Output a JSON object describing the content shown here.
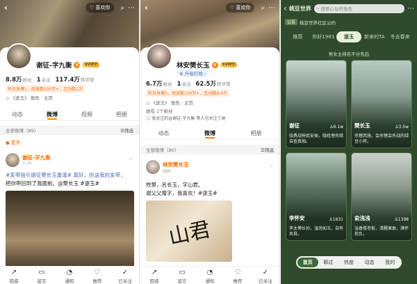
{
  "panel1": {
    "topbar": {
      "back": "‹",
      "pill": "喜欢你",
      "icons": [
        "search-icon",
        "more-icon"
      ]
    },
    "user": {
      "name": "谢征-字九衡",
      "svip": "SVIP7"
    },
    "stats": [
      {
        "num": "8.8万",
        "label": "粉丝"
      },
      {
        "num": "1",
        "label": "关注"
      },
      {
        "num": "117.4万",
        "label": "转评赞"
      }
    ],
    "tags": [
      "昨日发博1，阅读数100万+，互动数1万"
    ],
    "info": "《逐玉》 角色 · 主页",
    "info2": "谢征 角色微博",
    "tabs": [
      "动态",
      "微博",
      "视频",
      "相册"
    ],
    "active_tab": "微博",
    "feed_head": "全部微博（89）",
    "filter": "筛选",
    "top_label": "置顶",
    "post": {
      "name": "谢征-字九衡",
      "time": "3-16",
      "text1": "#发带指引谢征樊长玉重逢# 真好，你送我的发带，",
      "text2": "把你带回到了我面前。@樊长玉 #逐玉#"
    },
    "bottom": [
      "陪威",
      "留言",
      "通知",
      "推荐",
      "已关注"
    ]
  },
  "panel2": {
    "topbar": {
      "back": "‹",
      "pill": "喜欢你",
      "icons": [
        "search-icon",
        "more-icon"
      ]
    },
    "user": {
      "name": "林安樊长玉",
      "svip": "SVIP7",
      "upgrade": "升级打榜"
    },
    "stats": [
      {
        "num": "6.7万",
        "label": "粉丝"
      },
      {
        "num": "1",
        "label": "关注"
      },
      {
        "num": "62.5万",
        "label": "转评赞"
      }
    ],
    "tags": [
      "昨日发博1，阅读数100万+，互动数8.4万"
    ],
    "info": "《逐玉》 角色 · 主页",
    "info2": "她有 1个粉丝",
    "info3": "我关注的@谢征-字九衡 等人也关注了她",
    "tabs": [
      "动态",
      "微博",
      "相册"
    ],
    "active_tab": "微博",
    "feed_head": "全部微博（80）",
    "filter": "筛选",
    "post": {
      "name": "林安樊长玉",
      "time": "刚刚",
      "text1": "姓樊，名长玉，字山君。",
      "text2": "谢父父赠字，我喜欢！#逐玉#"
    },
    "calligraphy": "山君",
    "bottom": [
      "陪威",
      "留言",
      "通知",
      "推荐",
      "已关注"
    ]
  },
  "panel3": {
    "header": {
      "back": "‹",
      "title": "桃豆世界",
      "search_placeholder": "搜索心仪的角色",
      "more": "⋯"
    },
    "notice": {
      "label": "公告",
      "text": "桃豆世界社区公约"
    },
    "tabs": [
      "推荐",
      "你好1983",
      "逐玉",
      "新来的TA",
      "冬去春来"
    ],
    "active_tab": "逐玉",
    "banner": "男女主排名不分先后",
    "cards": [
      {
        "name": "谢征",
        "fans": "6.1w",
        "desc": "骁勇战神武安侯，隐姓埋名暗自查真相。"
      },
      {
        "name": "樊长玉",
        "fans": "3.5w",
        "desc": "杀猪西施，会杀猪会杀战的绿豆小将。"
      },
      {
        "name": "李怀安",
        "fans": "1631",
        "desc": "李太傅长孙，温润如玉，自有风骨。"
      },
      {
        "name": "俞浅浅",
        "fans": "1398",
        "desc": "溢香楼老板，清醒果敢，满怀抱负。"
      }
    ],
    "navbar": [
      "首页",
      "聊过",
      "热度",
      "动态",
      "我的"
    ],
    "active_nav": "首页"
  }
}
